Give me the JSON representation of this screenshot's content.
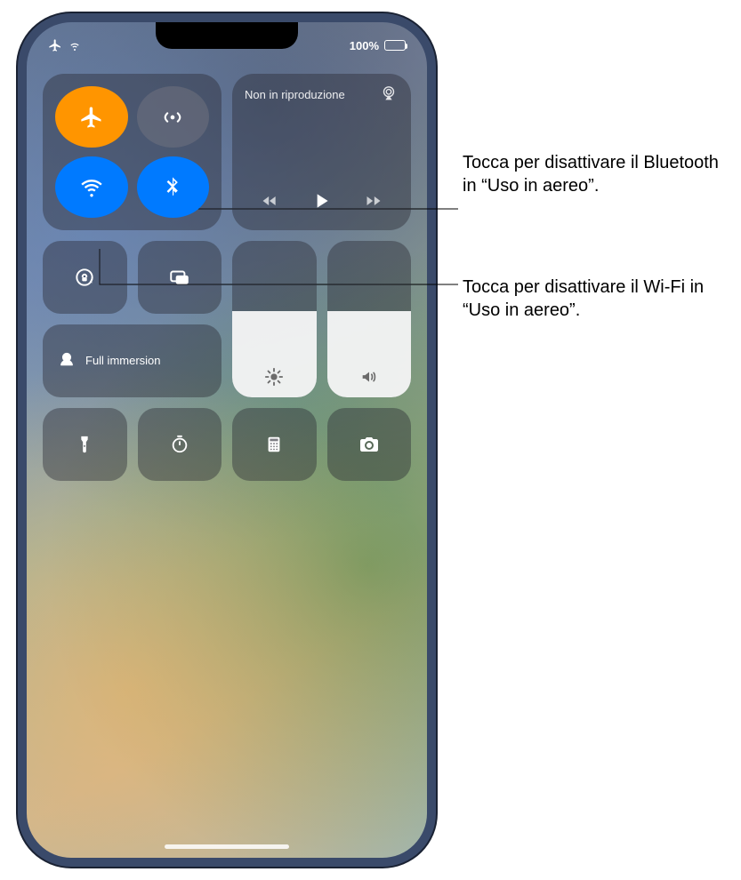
{
  "status": {
    "battery_pct": "100%"
  },
  "media": {
    "title": "Non in riproduzione"
  },
  "focus": {
    "label": "Full immersion"
  },
  "callouts": {
    "bluetooth": "Tocca per disattivare il Bluetooth in “Uso in aereo”.",
    "wifi": "Tocca per disattivare il Wi-Fi in “Uso in aereo”."
  },
  "colors": {
    "active_orange": "#ff9500",
    "active_blue": "#007aff",
    "tile_bg": "rgba(40,40,50,0.42)"
  }
}
